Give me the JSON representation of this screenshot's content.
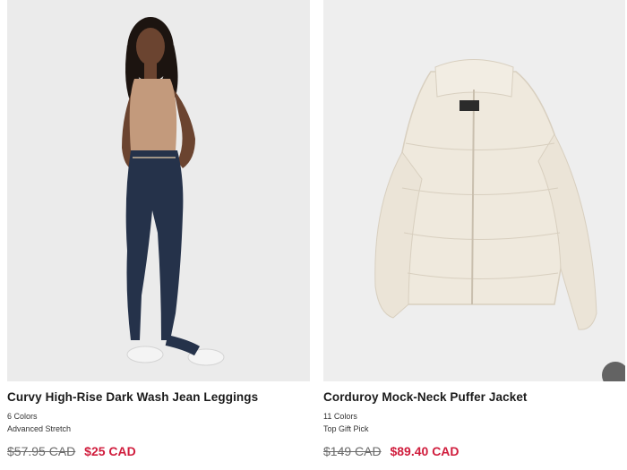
{
  "products": [
    {
      "title": "Curvy High-Rise Dark Wash Jean Leggings",
      "colors": "6 Colors",
      "tag": "Advanced Stretch",
      "price_old": "$57.95 CAD",
      "price_sale": "$25 CAD"
    },
    {
      "title": "Corduroy Mock-Neck Puffer Jacket",
      "colors": "11 Colors",
      "tag": "Top Gift Pick",
      "price_old": "$149 CAD",
      "price_sale": "$89.40 CAD"
    }
  ],
  "colors": {
    "sale": "#d01c3c",
    "old_price": "#6b6b6b",
    "image_bg": "#ececec"
  },
  "icons": {
    "carousel": "circle-arrow-icon"
  }
}
